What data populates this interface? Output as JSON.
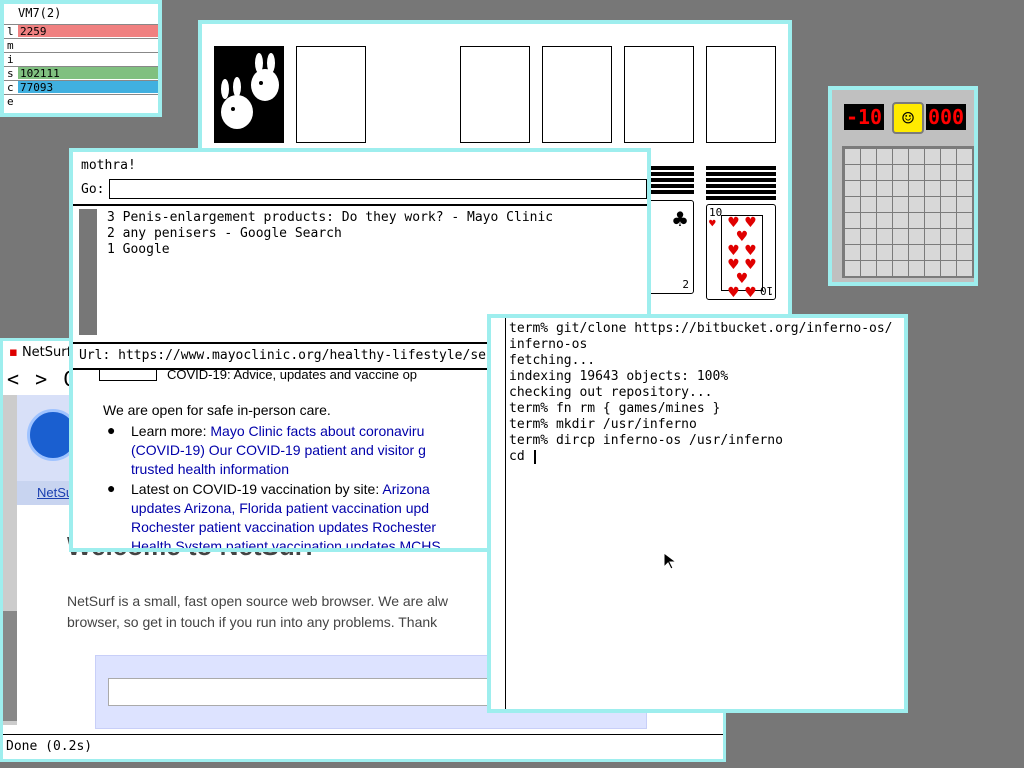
{
  "stats": {
    "title": "VM7(2)",
    "rows": [
      {
        "label": "l",
        "value": "2259",
        "color": "#f08080"
      },
      {
        "label": "m",
        "value": "",
        "color": "#ffffff"
      },
      {
        "label": "i",
        "value": "",
        "color": "#ffffff"
      },
      {
        "label": "s",
        "value": "102111",
        "color": "#80c080"
      },
      {
        "label": "c",
        "value": "77093",
        "color": "#40b0e0"
      },
      {
        "label": "e",
        "value": "",
        "color": "#ffffff"
      }
    ]
  },
  "solitaire": {
    "card_left": {
      "rank": "",
      "suit": "♣"
    },
    "card_right": {
      "rank": "10",
      "suit": "♥"
    },
    "card_left_corner": "2"
  },
  "mines": {
    "counter_left": "-10",
    "counter_right": "000",
    "face": "☺"
  },
  "netsurf": {
    "title": "NetSurf",
    "nav": "< > C",
    "tab_label": "NetSu",
    "heading": "Welcome to NetSurf",
    "para_line1": "NetSurf is a small, fast open source web browser. We are alw",
    "para_line2": "browser, so get in touch if you run into any problems. Thank",
    "status": "Done (0.2s)"
  },
  "mothra": {
    "title": "mothra!",
    "go_label": "Go:",
    "history": [
      "3 Penis-enlargement products: Do they work? - Mayo Clinic",
      "2 any penisers - Google Search",
      "1 Google"
    ],
    "url_label": "Url:",
    "url": "https://www.mayoclinic.org/healthy-lifestyle/se",
    "page": {
      "covid_banner": "COVID-19: Advice, updates and vaccine op",
      "open_text": "We are open for safe in-person care.",
      "b1_prefix": "Learn more:",
      "b1_link1": "Mayo Clinic facts about coronaviru",
      "b1_link2": "(COVID-19) Our COVID-19 patient and visitor g",
      "b1_link3": "trusted health information",
      "b2_prefix": "Latest on COVID-19 vaccination by site:",
      "b2_link1": "Arizona",
      "b2_link2": "updates Arizona,",
      "b2_link3": "Florida patient vaccination upd",
      "b2_link4": "Rochester patient vaccination updates Rochester",
      "b2_link5": "Health System patient vaccination updates MCHS"
    }
  },
  "terminal": {
    "lines": [
      "term% git/clone https://bitbucket.org/inferno-os/",
      "inferno-os",
      "fetching...",
      "indexing 19643 objects: 100%",
      "checking out repository...",
      "term% fn rm { games/mines }",
      "term% mkdir /usr/inferno",
      "term% dircp inferno-os /usr/inferno",
      "cd "
    ]
  }
}
